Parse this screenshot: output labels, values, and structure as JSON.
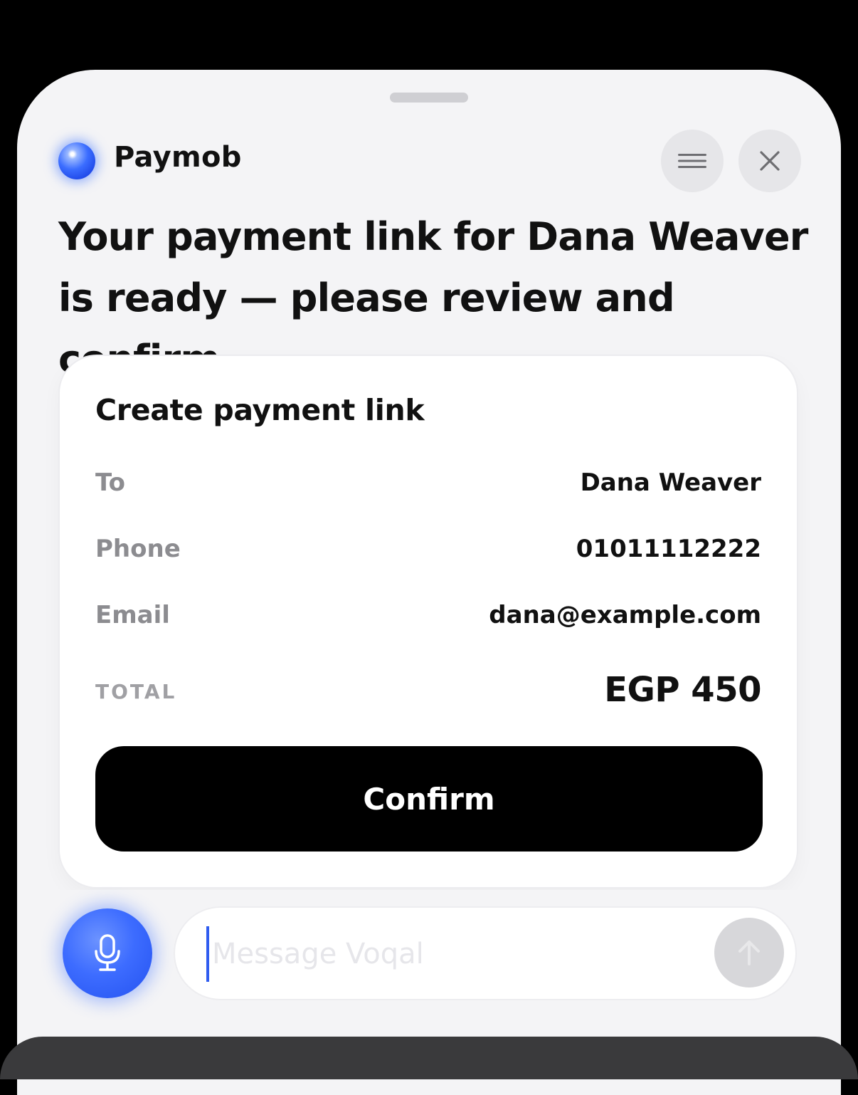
{
  "header": {
    "brand_name": "Paymob",
    "menu_icon": "hamburger-icon",
    "close_icon": "close-icon"
  },
  "message": {
    "headline": "Your payment link for Dana Weaver is ready — please review and confirm."
  },
  "card": {
    "title": "Create payment link",
    "rows": [
      {
        "label": "To",
        "value": "Dana Weaver"
      },
      {
        "label": "Phone",
        "value": "01011112222"
      },
      {
        "label": "Email",
        "value": "dana@example.com"
      }
    ],
    "total_label": "TOTAL",
    "total_value": "EGP 450",
    "confirm_label": "Confirm"
  },
  "composer": {
    "placeholder": "Message Voqal",
    "mic_icon": "microphone-icon",
    "send_icon": "arrow-up-icon"
  },
  "colors": {
    "accent": "#3d6cff",
    "confirm_bg": "#000000",
    "sheet_bg": "#f4f4f6"
  }
}
